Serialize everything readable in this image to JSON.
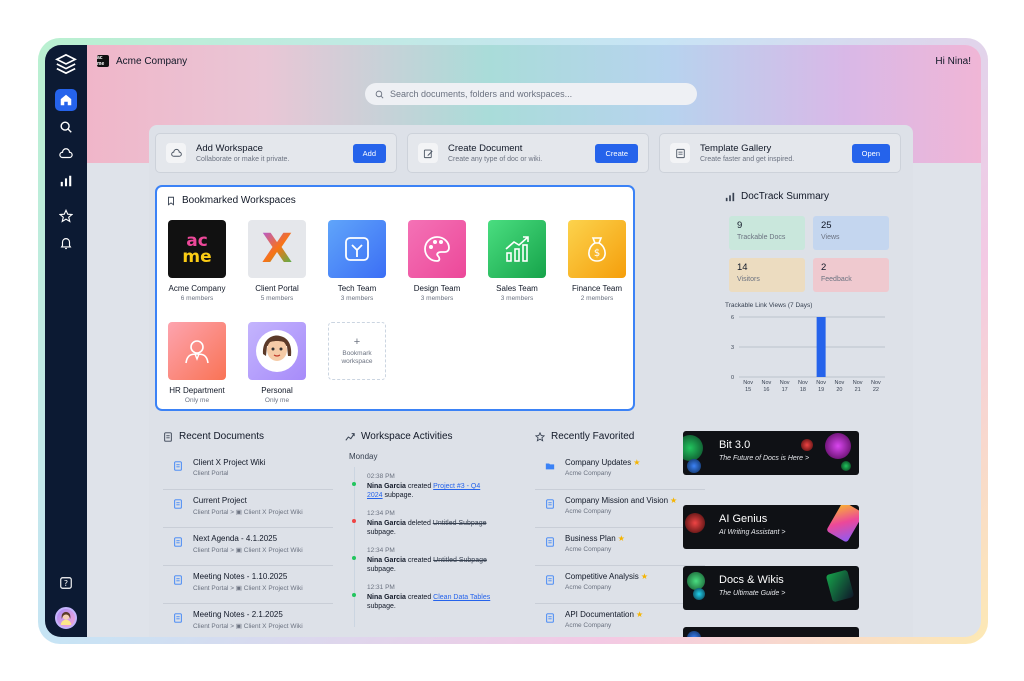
{
  "header": {
    "company": "Acme Company",
    "company_icon_text": "ac me",
    "greeting": "Hi Nina!",
    "search_placeholder": "Search documents, folders and workspaces..."
  },
  "sidebar": {
    "items": [
      {
        "name": "home-icon",
        "active": true
      },
      {
        "name": "search-icon",
        "active": false
      },
      {
        "name": "workspaces-icon",
        "active": false
      },
      {
        "name": "analytics-icon",
        "active": false
      },
      {
        "name": "favorites-icon",
        "active": false
      },
      {
        "name": "notifications-icon",
        "active": false
      }
    ],
    "help_icon": "question-icon"
  },
  "actions": [
    {
      "title": "Add Workspace",
      "subtitle": "Collaborate or make it private.",
      "button": "Add",
      "icon": "cloud-icon"
    },
    {
      "title": "Create Document",
      "subtitle": "Create any type of doc or wiki.",
      "button": "Create",
      "icon": "edit-icon"
    },
    {
      "title": "Template Gallery",
      "subtitle": "Create faster and get inspired.",
      "button": "Open",
      "icon": "template-icon"
    }
  ],
  "bookmarks": {
    "title": "Bookmarked Workspaces",
    "items": [
      {
        "name": "Acme Company",
        "meta": "6 members",
        "color": "#111111",
        "logo_text_1": "ac",
        "logo_text_2": "me"
      },
      {
        "name": "Client Portal",
        "meta": "5 members",
        "color": "#e5e7eb",
        "logo_text_1": "X"
      },
      {
        "name": "Tech Team",
        "meta": "3 members",
        "color": "#4f8df7"
      },
      {
        "name": "Design Team",
        "meta": "3 members",
        "color": "#f04fa8"
      },
      {
        "name": "Sales Team",
        "meta": "3 members",
        "color": "#22c55e"
      },
      {
        "name": "Finance Team",
        "meta": "2 members",
        "color": "#f5b33f"
      },
      {
        "name": "HR Department",
        "meta": "Only me",
        "color": "#f9886b"
      },
      {
        "name": "Personal",
        "meta": "Only me",
        "color": "#a78bfa"
      }
    ],
    "add_label": "Bookmark workspace",
    "add_symbol": "+"
  },
  "doctrack": {
    "title": "DocTrack Summary",
    "stats": [
      {
        "value": "9",
        "label": "Trackable Docs",
        "bg": "#c9e7dc"
      },
      {
        "value": "25",
        "label": "Views",
        "bg": "#c4d6ef"
      },
      {
        "value": "14",
        "label": "Visitors",
        "bg": "#ecdcc0"
      },
      {
        "value": "2",
        "label": "Feedback",
        "bg": "#efc9cf"
      }
    ],
    "chart_title": "Trackable Link Views (7 Days)"
  },
  "chart_data": {
    "type": "bar",
    "categories": [
      "Nov 15",
      "Nov 16",
      "Nov 17",
      "Nov 18",
      "Nov 19",
      "Nov 20",
      "Nov 21",
      "Nov 22"
    ],
    "cat_month": [
      "Nov",
      "Nov",
      "Nov",
      "Nov",
      "Nov",
      "Nov",
      "Nov",
      "Nov"
    ],
    "cat_day": [
      "15",
      "16",
      "17",
      "18",
      "19",
      "20",
      "21",
      "22"
    ],
    "values": [
      0,
      0,
      0,
      0,
      6,
      0,
      0,
      0
    ],
    "yticks": [
      "0",
      "3",
      "6"
    ],
    "ylim": [
      0,
      6
    ],
    "color": "#2563eb"
  },
  "recent_documents": {
    "title": "Recent Documents",
    "items": [
      {
        "title": "Client X Project Wiki",
        "sub": "Client Portal"
      },
      {
        "title": "Current Project",
        "sub": "Client Portal >  ▣  Client X Project Wiki"
      },
      {
        "title": "Next Agenda - 4.1.2025",
        "sub": "Client Portal >  ▣  Client X Project Wiki"
      },
      {
        "title": "Meeting Notes - 1.10.2025",
        "sub": "Client Portal >  ▣  Client X Project Wiki"
      },
      {
        "title": "Meeting Notes - 2.1.2025",
        "sub": "Client Portal >  ▣  Client X Project Wiki"
      }
    ]
  },
  "activities": {
    "title": "Workspace Activities",
    "day": "Monday",
    "items": [
      {
        "time": "02:38 PM",
        "user": "Nina Garcia",
        "action": " created ",
        "target": "Project #3 - Q4 2024",
        "suffix": " subpage.",
        "style": "link",
        "dot": "#22c55e"
      },
      {
        "time": "12:34 PM",
        "user": "Nina Garcia",
        "action": " deleted ",
        "target": "Untitled Subpage",
        "suffix": " subpage.",
        "style": "strike",
        "dot": "#ef4444"
      },
      {
        "time": "12:34 PM",
        "user": "Nina Garcia",
        "action": " created ",
        "target": "Untitled Subpage",
        "suffix": " subpage.",
        "style": "strike",
        "dot": "#22c55e"
      },
      {
        "time": "12:31 PM",
        "user": "Nina Garcia",
        "action": " created ",
        "target": "Clean Data Tables",
        "suffix": " subpage.",
        "style": "link",
        "dot": "#22c55e"
      }
    ]
  },
  "favorites": {
    "title": "Recently Favorited",
    "items": [
      {
        "title": "Company Updates",
        "sub": "Acme Company",
        "icon": "folder-icon"
      },
      {
        "title": "Company Mission and Vision",
        "sub": "Acme Company",
        "icon": "document-icon"
      },
      {
        "title": "Business Plan",
        "sub": "Acme Company",
        "icon": "document-icon"
      },
      {
        "title": "Competitive Analysis",
        "sub": "Acme Company",
        "icon": "document-icon"
      },
      {
        "title": "API Documentation",
        "sub": "Acme Company",
        "icon": "document-icon"
      }
    ],
    "star": "★"
  },
  "promos": [
    {
      "title": "Bit 3.0",
      "subtitle": "The Future of Docs is Here",
      "arrow": ">"
    },
    {
      "title": "AI Genius",
      "subtitle": "AI Writing Assistant",
      "arrow": ">"
    },
    {
      "title": "Docs & Wikis",
      "subtitle": "The Ultimate Guide",
      "arrow": ">"
    }
  ]
}
